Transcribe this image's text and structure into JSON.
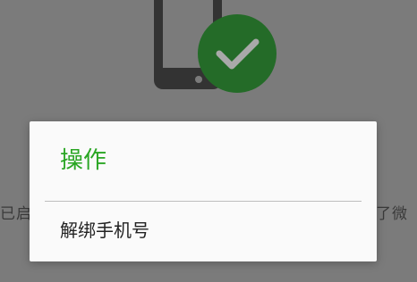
{
  "background": {
    "text_left": "已启",
    "text_right": "了微"
  },
  "dialog": {
    "title": "操作",
    "items": [
      {
        "label": "解绑手机号"
      }
    ]
  },
  "colors": {
    "accent": "#2aa624",
    "check_badge": "#246b28",
    "overlay_bg": "#7b7b7b",
    "dialog_bg": "#fafafa"
  },
  "icons": {
    "illustration": "phone-verified-icon",
    "badge": "check-icon"
  }
}
